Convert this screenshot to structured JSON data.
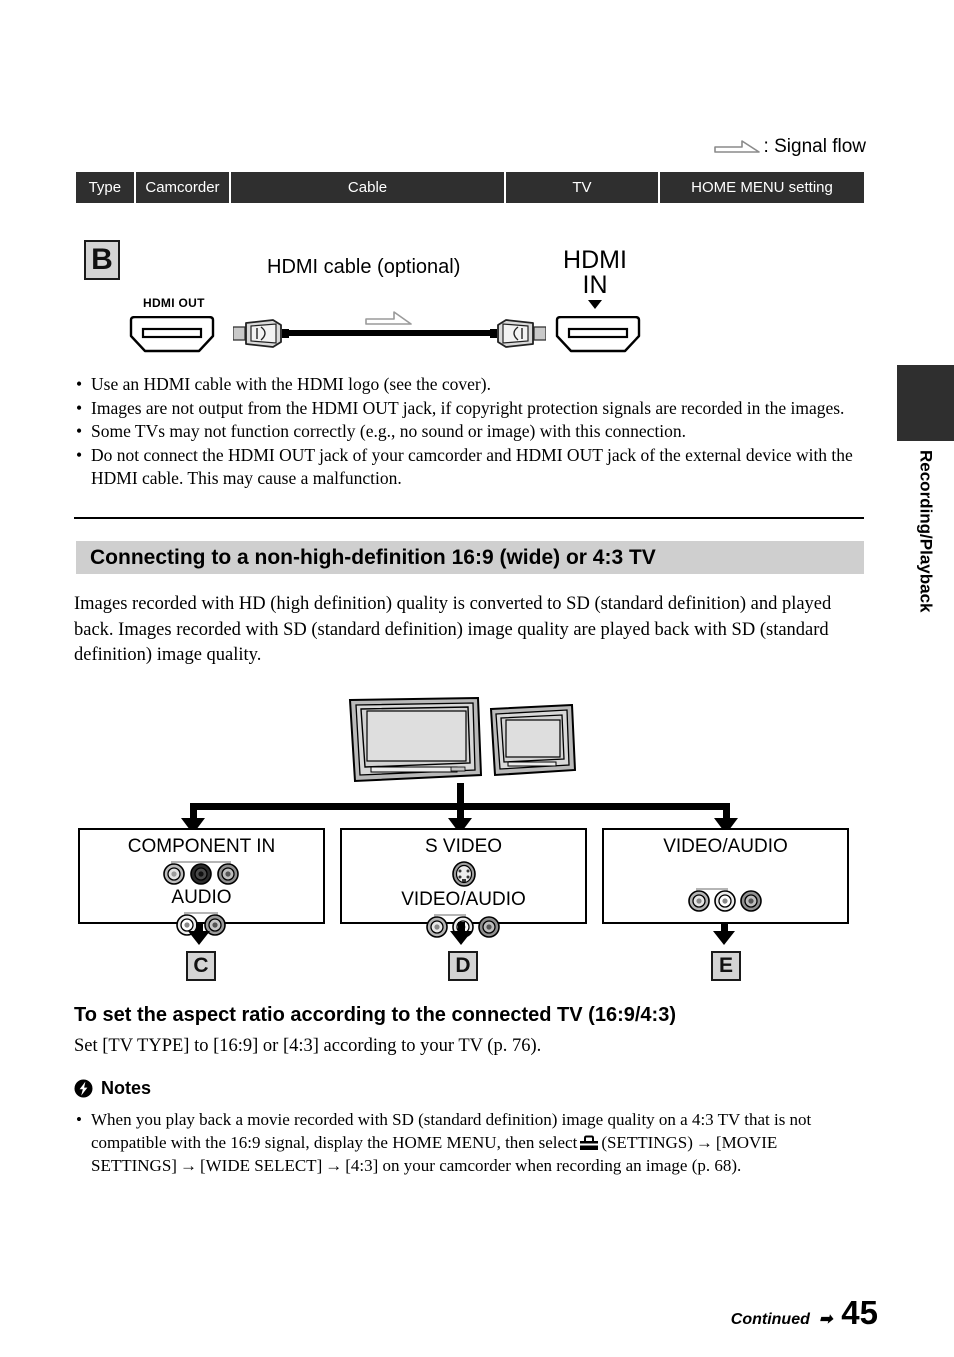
{
  "legend": {
    "text": ": Signal flow",
    "icon": "signal-flow-arrow-icon"
  },
  "table": {
    "columns": [
      "Type",
      "Camcorder",
      "Cable",
      "TV",
      "HOME MENU setting"
    ],
    "header_bg": "#2f2f2f",
    "header_fg": "#ffffff"
  },
  "hdmi_diagram": {
    "type_badge": "B",
    "cable_label": "HDMI cable (optional)",
    "camcorder_jack_label": "HDMI OUT",
    "tv_jack_label_line1": "HDMI",
    "tv_jack_label_line2": "IN"
  },
  "hdmi_notes": [
    "Use an HDMI cable with the HDMI logo (see the cover).",
    "Images are not output from the HDMI OUT jack, if copyright protection signals are recorded in the images.",
    "Some TVs may not function correctly (e.g., no sound or image) with this connection.",
    "Do not connect the HDMI OUT jack of your camcorder and HDMI OUT jack of the external device with the HDMI cable. This may cause a malfunction."
  ],
  "section": {
    "heading": "Connecting to a non-high-definition 16:9 (wide) or 4:3 TV",
    "heading_bg": "#cfcfcf",
    "intro": "Images recorded with HD (high definition) quality is converted to SD (standard definition) and played back. Images recorded with SD (standard definition) image quality are played back with SD (standard definition) image quality."
  },
  "connection_boxes": [
    {
      "title": "COMPONENT IN",
      "title2": "AUDIO",
      "badge": "C"
    },
    {
      "title": "S VIDEO",
      "title2": "VIDEO/AUDIO",
      "badge": "D"
    },
    {
      "title": "VIDEO/AUDIO",
      "title2": "",
      "badge": "E"
    }
  ],
  "aspect": {
    "heading": "To set the aspect ratio according to the connected TV (16:9/4:3)",
    "text": "Set [TV TYPE] to [16:9] or [4:3] according to your TV (p. 76)."
  },
  "notes": {
    "label": "Notes",
    "icon": "bolt-circle-icon",
    "item_part1": "When you play back a movie recorded with SD (standard definition) image quality on a 4:3 TV that is not compatible with the 16:9 signal, display the HOME MENU, then select",
    "settings_icon": "toolbox-icon",
    "item_part2": "(SETTINGS)",
    "arrow1": "→",
    "item_part3": "[MOVIE SETTINGS]",
    "arrow2": "→",
    "item_part4": "[WIDE SELECT]",
    "arrow3": "→",
    "item_part5": "[4:3] on your camcorder when recording an image (p. 68)."
  },
  "side_tab": {
    "label": "Recording/Playback",
    "color": "#2f2f2f"
  },
  "footer": {
    "continued": "Continued",
    "arrow": "➡",
    "page": "45"
  }
}
